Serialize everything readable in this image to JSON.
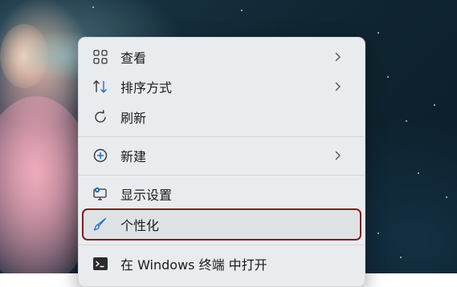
{
  "context_menu": {
    "items": [
      {
        "label": "查看",
        "icon": "grid-view-icon",
        "has_submenu": true
      },
      {
        "label": "排序方式",
        "icon": "sort-arrows-icon",
        "has_submenu": true
      },
      {
        "label": "刷新",
        "icon": "refresh-icon",
        "has_submenu": false
      },
      {
        "label": "新建",
        "icon": "add-circle-icon",
        "has_submenu": true
      },
      {
        "label": "显示设置",
        "icon": "display-settings-icon",
        "has_submenu": false
      },
      {
        "label": "个性化",
        "icon": "brush-icon",
        "has_submenu": false,
        "highlighted": true
      },
      {
        "label": "在 Windows 终端 中打开",
        "icon": "terminal-icon",
        "has_submenu": false
      }
    ]
  },
  "colors": {
    "menu_background": "#e9ecef",
    "highlight_outline": "#7a1f24",
    "accent_icon": "#1f6fbf"
  }
}
